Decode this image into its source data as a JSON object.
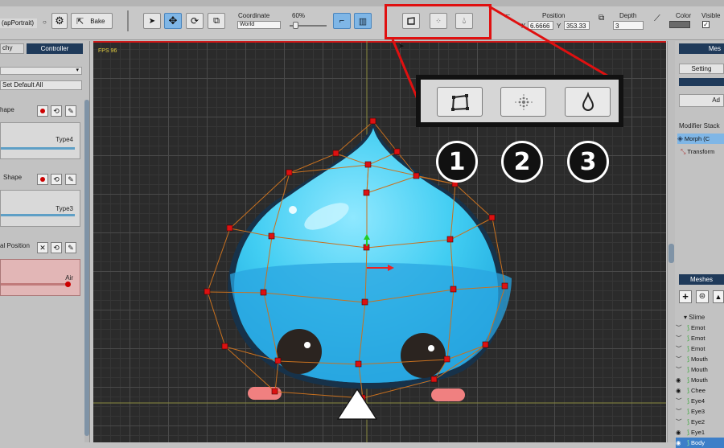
{
  "toolbar": {
    "project_name": "(apPortrait)",
    "bake_label": "Bake",
    "coordinate_label": "Coordinate",
    "coordinate_value": "World",
    "zoom_label": "60%",
    "position_label": "Position",
    "pos_x_label": "X",
    "pos_x_value": "6.6666",
    "pos_y_label": "Y",
    "pos_y_value": "353.33",
    "depth_label": "Depth",
    "depth_value": "3",
    "color_label": "Color",
    "visible_label": "Visible"
  },
  "left_panel": {
    "tab_hierarchy": "chy",
    "tab_controller": "Controller",
    "set_default_label": "Set Default All",
    "controllers": [
      {
        "name": "hape",
        "type_label": "Type4",
        "slider_value": 0.0
      },
      {
        "name": "Shape",
        "type_label": "Type3",
        "slider_value": 0.0
      },
      {
        "name": "al Position",
        "type_label": "Air",
        "slider_value": 1.0
      }
    ]
  },
  "viewport": {
    "fps_label": "FPS 96"
  },
  "callout": {
    "numbers": [
      "1",
      "2",
      "3"
    ]
  },
  "right_panel": {
    "mesh_tab": "Mes",
    "setting_label": "Setting",
    "add_label": "Ad",
    "modifier_stack_label": "Modifier Stack",
    "modifiers": [
      "Morph (C",
      "Transform"
    ],
    "meshes_header": "Meshes",
    "root_label": "Slime",
    "mesh_items": [
      "Emot",
      "Emot",
      "Emot",
      "Mouth",
      "Mouth",
      "Mouth",
      "Chee",
      "Eye4",
      "Eye3",
      "Eye2",
      "Eye1",
      "Body"
    ]
  },
  "colors": {
    "accent_blue": "#7fb6e6",
    "highlight_red": "#e01010",
    "selection_blue": "#3d7fc8",
    "slime_blue": "#4fd2f5"
  }
}
